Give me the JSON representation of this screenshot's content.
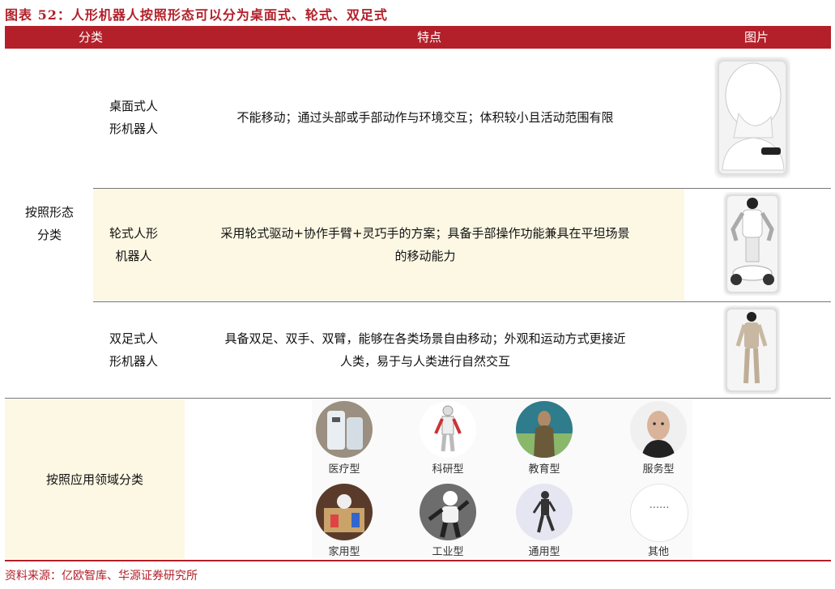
{
  "title": "图表 52：人形机器人按照形态可以分为桌面式、轮式、双足式",
  "header": {
    "category": "分类",
    "features": "特点",
    "picture": "图片"
  },
  "group_form": "按照形态\n分类",
  "rows": [
    {
      "type": "桌面式人\n形机器人",
      "desc": "不能移动；通过头部或手部动作与环境交互；体积较小且活动范围有限"
    },
    {
      "type": "轮式人形\n机器人",
      "desc": "采用轮式驱动+协作手臂+灵巧手的方案；具备手部操作功能兼具在平坦场景\n的移动能力"
    },
    {
      "type": "双足式人\n形机器人",
      "desc": "具备双足、双手、双臂，能够在各类场景自由移动；外观和运动方式更接近\n人类，易于与人类进行自然交互"
    }
  ],
  "group_application": "按照应用领域分类",
  "applications": [
    "医疗型",
    "科研型",
    "教育型",
    "服务型",
    "家用型",
    "工业型",
    "通用型",
    "其他"
  ],
  "other_dots": "......",
  "source": "资料来源：亿欧智库、华源证券研究所",
  "colors": {
    "accent": "#b3202a",
    "shade": "#fdf8e4"
  }
}
